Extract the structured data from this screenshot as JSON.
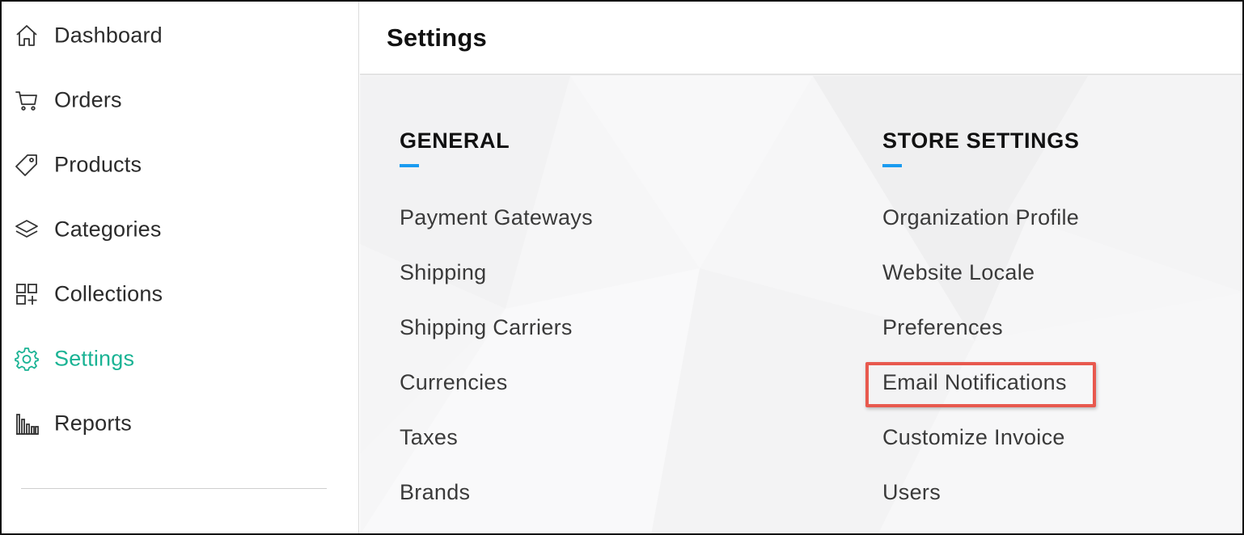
{
  "sidebar": {
    "items": [
      {
        "label": "Dashboard",
        "icon": "home-icon",
        "active": false
      },
      {
        "label": "Orders",
        "icon": "cart-icon",
        "active": false
      },
      {
        "label": "Products",
        "icon": "tag-icon",
        "active": false
      },
      {
        "label": "Categories",
        "icon": "layers-icon",
        "active": false
      },
      {
        "label": "Collections",
        "icon": "grid-plus-icon",
        "active": false
      },
      {
        "label": "Settings",
        "icon": "gear-icon",
        "active": true
      },
      {
        "label": "Reports",
        "icon": "bar-chart-icon",
        "active": false
      }
    ]
  },
  "header": {
    "title": "Settings"
  },
  "general": {
    "heading": "GENERAL",
    "links": [
      "Payment Gateways",
      "Shipping",
      "Shipping Carriers",
      "Currencies",
      "Taxes",
      "Brands"
    ]
  },
  "store_settings": {
    "heading": "STORE SETTINGS",
    "links": [
      "Organization Profile",
      "Website Locale",
      "Preferences",
      "Email Notifications",
      "Customize Invoice",
      "Users"
    ],
    "highlighted": "Email Notifications"
  },
  "colors": {
    "accent": "#1ab394",
    "underline": "#1a9bf0",
    "highlight": "#e8594e"
  }
}
